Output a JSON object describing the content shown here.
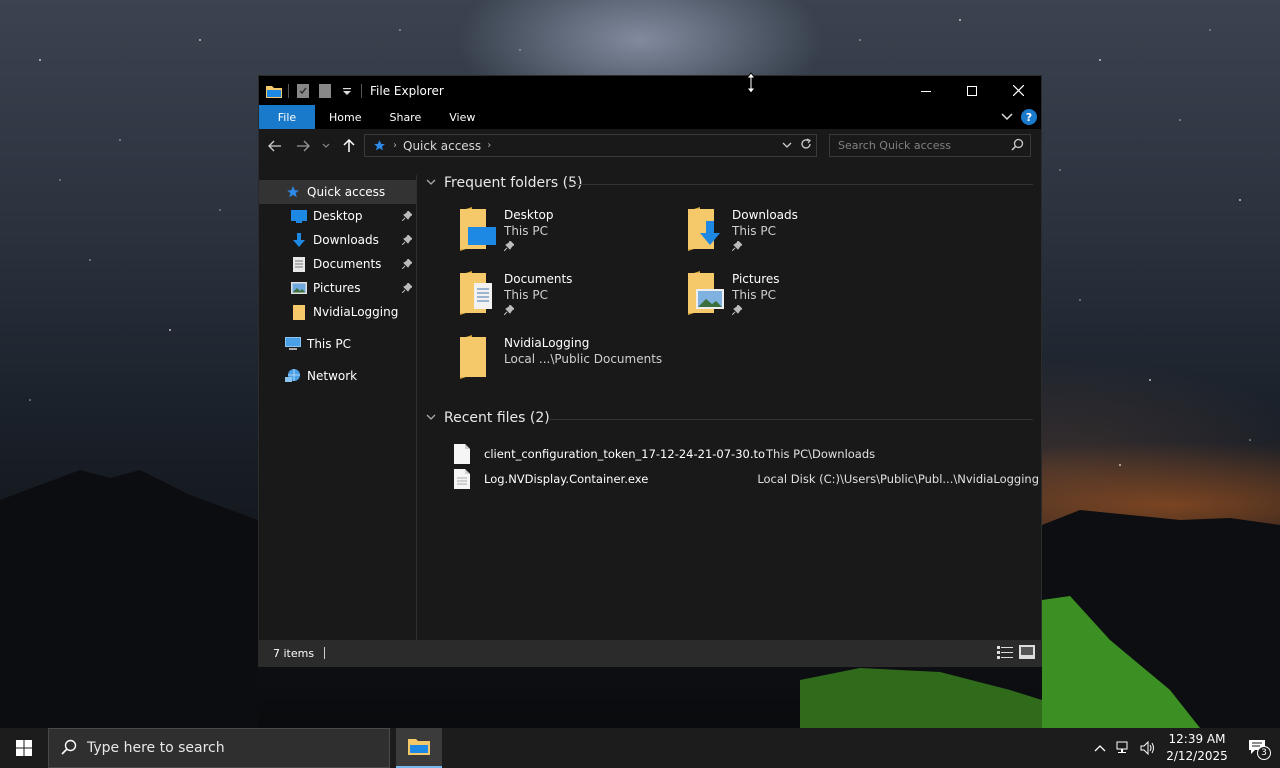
{
  "window": {
    "title": "File Explorer",
    "controls": {
      "minimize": "—",
      "maximize": "☐",
      "close": "✕"
    }
  },
  "ribbon": {
    "tabs": [
      "File",
      "Home",
      "Share",
      "View"
    ],
    "help": "?"
  },
  "navbar": {
    "address_segments": [
      "Quick access"
    ],
    "search_placeholder": "Search Quick access"
  },
  "sidebar": {
    "items": [
      {
        "label": "Quick access",
        "icon": "star-icon",
        "selected": true
      },
      {
        "label": "Desktop",
        "icon": "desktop-icon",
        "pinned": true
      },
      {
        "label": "Downloads",
        "icon": "download-icon",
        "pinned": true
      },
      {
        "label": "Documents",
        "icon": "document-icon",
        "pinned": true
      },
      {
        "label": "Pictures",
        "icon": "pictures-icon",
        "pinned": true
      },
      {
        "label": "NvidiaLogging",
        "icon": "folder-icon"
      },
      {
        "label": "This PC",
        "icon": "computer-icon"
      },
      {
        "label": "Network",
        "icon": "network-icon"
      }
    ]
  },
  "frequent": {
    "header": "Frequent folders (5)",
    "folders": [
      {
        "name": "Desktop",
        "location": "This PC",
        "pinned": true
      },
      {
        "name": "Downloads",
        "location": "This PC",
        "pinned": true
      },
      {
        "name": "Documents",
        "location": "This PC",
        "pinned": true
      },
      {
        "name": "Pictures",
        "location": "This PC",
        "pinned": true
      },
      {
        "name": "NvidiaLogging",
        "location": "Local ...\\Public Documents",
        "pinned": false
      }
    ]
  },
  "recent": {
    "header": "Recent files (2)",
    "files": [
      {
        "name": "client_configuration_token_17-12-24-21-07-30.tok",
        "path": "This PC\\Downloads"
      },
      {
        "name": "Log.NVDisplay.Container.exe",
        "path": "Local Disk (C:)\\Users\\Public\\Publ...\\NvidiaLogging"
      }
    ]
  },
  "status": {
    "items": "7 items"
  },
  "taskbar": {
    "search_placeholder": "Type here to search",
    "time": "12:39 AM",
    "date": "2/12/2025",
    "notification_count": "3"
  },
  "colors": {
    "accent": "#1979ca",
    "folder": "#f5c86a",
    "window_bg": "#191919"
  }
}
